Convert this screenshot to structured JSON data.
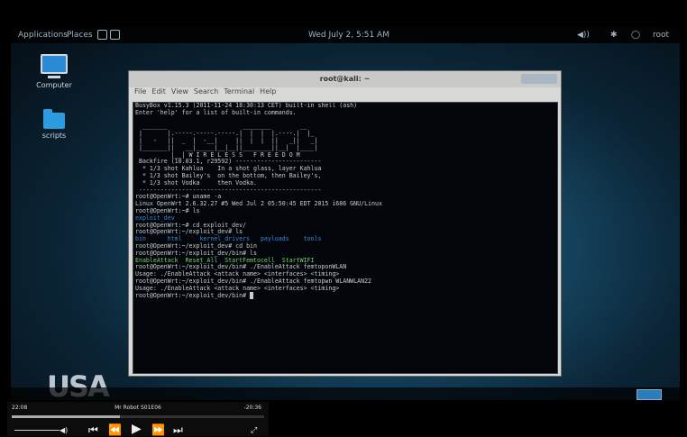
{
  "topbar": {
    "applications": "Applications",
    "places": "Places",
    "clock": "Wed July 2, 5:51 AM",
    "user": "root"
  },
  "desktop": {
    "icons": [
      {
        "label": "Computer"
      },
      {
        "label": "scripts"
      }
    ],
    "watermark": "USA"
  },
  "window": {
    "title": "root@kali: ~",
    "menu": [
      "File",
      "Edit",
      "View",
      "Search",
      "Terminal",
      "Help"
    ]
  },
  "terminal": {
    "lines": [
      {
        "text": "BusyBox v1.15.3 (2011-11-24 18:30:13 CET) built-in shell (ash)",
        "cls": ""
      },
      {
        "text": "Enter 'help' for a list of built-in commands.",
        "cls": ""
      },
      {
        "text": "",
        "cls": ""
      },
      {
        "text": "  _______                     ________        __",
        "cls": "ascii"
      },
      {
        "text": " |       |.-----.-----.-----.|  |  |  |.----.|  |_",
        "cls": "ascii"
      },
      {
        "text": " |   -   ||  _  |  -__|     ||  |  |  ||   _||   _|",
        "cls": "ascii"
      },
      {
        "text": " |_______||   __|_____|__|__||________||__|  |____|",
        "cls": "ascii"
      },
      {
        "text": "          |__| W I R E L E S S   F R E E D O M",
        "cls": "ascii"
      },
      {
        "text": " Backfire (10.03.1, r29592) ------------------------",
        "cls": ""
      },
      {
        "text": "  * 1/3 shot Kahlua    In a shot glass, layer Kahlua",
        "cls": ""
      },
      {
        "text": "  * 1/3 shot Bailey's  on the bottom, then Bailey's,",
        "cls": ""
      },
      {
        "text": "  * 1/3 shot Vodka     then Vodka.",
        "cls": ""
      },
      {
        "text": " ---------------------------------------------------",
        "cls": ""
      },
      {
        "text": "root@OpenWrt:~# uname -a",
        "cls": ""
      },
      {
        "text": "Linux OpenWrt 2.6.32.27 #5 Wed Jul 2 05:50:45 EDT 2015 i686 GNU/Linux",
        "cls": ""
      },
      {
        "text": "root@OpenWrt:~# ls",
        "cls": ""
      },
      {
        "text": "exploit_dev",
        "cls": "blue"
      },
      {
        "text": "root@OpenWrt:~# cd exploit_dev/",
        "cls": ""
      },
      {
        "text": "root@OpenWrt:~/exploit_dev# ls",
        "cls": ""
      },
      {
        "text": "bin      html     kernel_drivers   payloads    tools",
        "cls": "blue"
      },
      {
        "text": "root@OpenWrt:~/exploit_dev# cd bin",
        "cls": ""
      },
      {
        "text": "root@OpenWrt:~/exploit_dev/bin# ls",
        "cls": ""
      },
      {
        "text": "EnableAttack  Reset_All  StartFemtocell  StartWIFI",
        "cls": "green"
      },
      {
        "text": "root@OpenWrt:~/exploit_dev/bin# ./EnableAttack femtoponWLAN",
        "cls": ""
      },
      {
        "text": "Usage: ./EnableAttack <attack name> <interfaces> <timing>",
        "cls": ""
      },
      {
        "text": "root@OpenWrt:~/exploit_dev/bin# ./EnableAttack femtopwn WLANWLAN22",
        "cls": ""
      },
      {
        "text": "Usage: ./EnableAttack <attack name> <interfaces> <timing>",
        "cls": ""
      },
      {
        "text": "root@OpenWrt:~/exploit_dev/bin# ",
        "cls": ""
      }
    ]
  },
  "player": {
    "elapsed": "22:08",
    "title": "Mr Robot S01E06",
    "remaining": "-20:36",
    "progress": 0.43
  }
}
